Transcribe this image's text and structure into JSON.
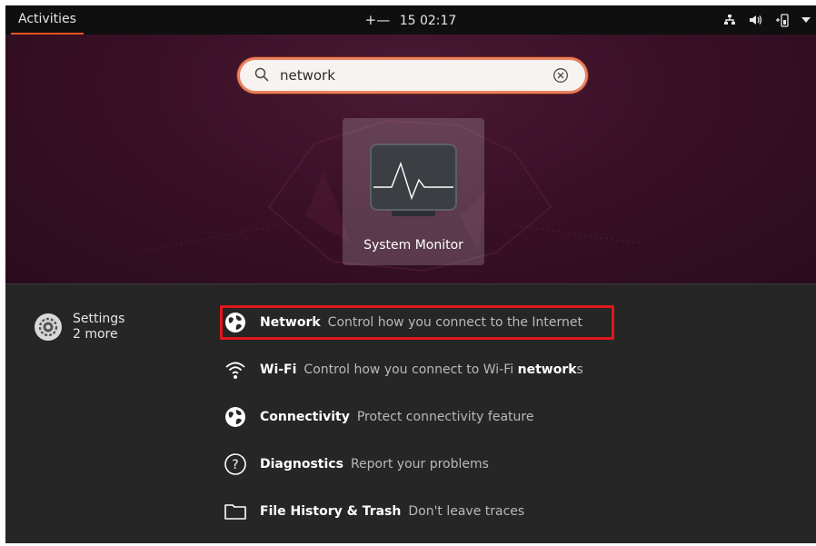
{
  "topbar": {
    "activities": "Activities",
    "input_method": "+—",
    "clock": "15 02:17",
    "tray_icons": [
      "network-icon",
      "volume-icon",
      "battery-icon",
      "dropdown-icon"
    ]
  },
  "search": {
    "value": "network",
    "icon": "search-icon",
    "clear_icon": "clear-icon"
  },
  "app_result": {
    "label": "System Monitor",
    "icon": "system-monitor-icon"
  },
  "settings_results": {
    "provider_name": "Settings",
    "provider_more": "2 more",
    "provider_icon": "settings-gear-icon",
    "items": [
      {
        "name": "Network",
        "desc": "Control how you connect to the Internet",
        "icon": "globe-icon",
        "highlighted": true
      },
      {
        "name": "Wi-Fi",
        "desc": "Control how you connect to Wi-Fi ",
        "desc_match": "network",
        "desc_tail": "s",
        "icon": "wifi-icon"
      },
      {
        "name": "Connectivity",
        "desc": "Protect connectivity feature",
        "icon": "globe-icon"
      },
      {
        "name": "Diagnostics",
        "desc": "Report your problems",
        "icon": "help-icon"
      },
      {
        "name": "File History & Trash",
        "desc": "Don't leave traces",
        "icon": "folder-icon"
      }
    ]
  },
  "colors": {
    "accent": "#e95420",
    "highlight_box": "#e1161c",
    "panel": "#262626"
  }
}
